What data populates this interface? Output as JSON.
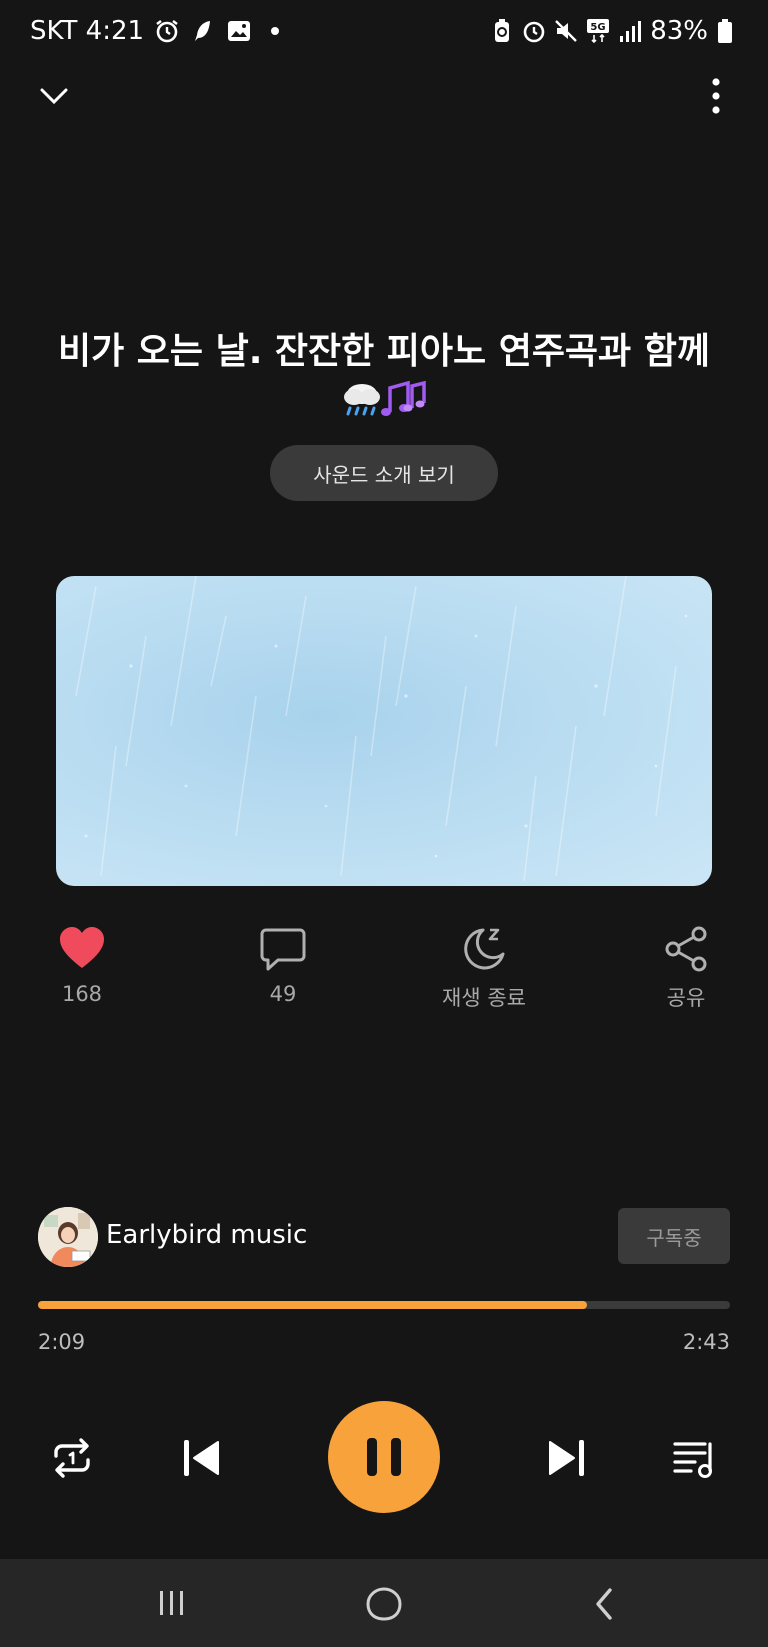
{
  "status_bar": {
    "carrier_time": "SKT 4:21",
    "battery": "83%",
    "network": "5G",
    "left_icons": [
      "alarm-icon",
      "feather-icon",
      "image-icon",
      "dot-icon"
    ],
    "right_icons": [
      "battery-saver-icon",
      "alarm-icon",
      "mute-icon",
      "5g-icon",
      "signal-icon",
      "battery-icon"
    ]
  },
  "header": {
    "collapse_icon": "chevron-down-icon",
    "more_icon": "more-vertical-icon"
  },
  "track": {
    "title": "비가 오는 날. 잔잔한 피아노 연주곡과 함께",
    "title_emoji": "🌧️🎶",
    "intro_button": "사운드 소개 보기"
  },
  "actions": {
    "like_count": "168",
    "comment_count": "49",
    "sleep_label": "재생 종료",
    "share_label": "공유"
  },
  "channel": {
    "name": "Earlybird music",
    "subscribe_label": "구독중"
  },
  "player": {
    "elapsed": "2:09",
    "total": "2:43",
    "progress_fraction": 0.794
  },
  "colors": {
    "accent": "#f7a23b",
    "like": "#ef4b5c",
    "background": "#151515"
  }
}
